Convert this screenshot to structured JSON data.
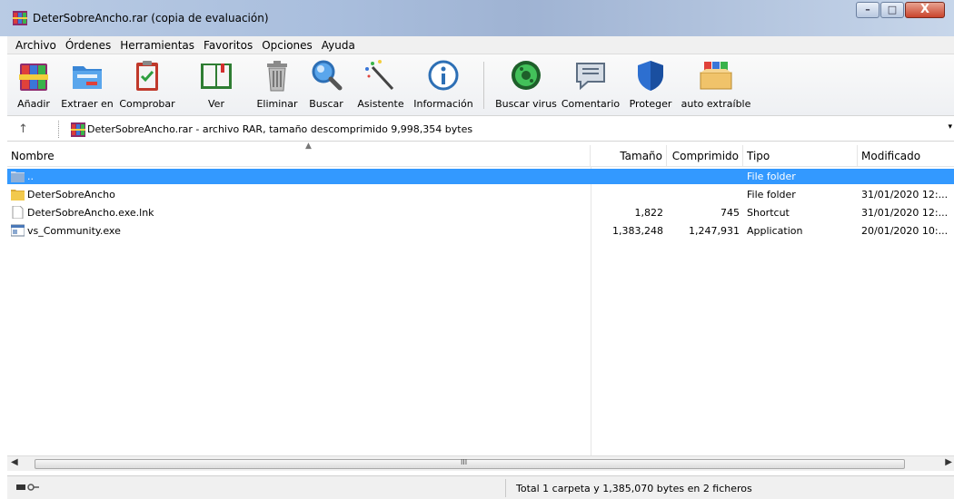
{
  "window": {
    "title": "DeterSobreAncho.rar (copia de evaluación)",
    "controls": {
      "minimize": "‗",
      "maximize": "☐",
      "close": "X"
    }
  },
  "menu": [
    "Archivo",
    "Órdenes",
    "Herramientas",
    "Favoritos",
    "Opciones",
    "Ayuda"
  ],
  "toolbar": [
    {
      "label": "Añadir",
      "icon": "add-archive-icon"
    },
    {
      "label": "Extraer en",
      "icon": "extract-folder-icon"
    },
    {
      "label": "Comprobar",
      "icon": "test-clipboard-icon"
    },
    {
      "label": "Ver",
      "icon": "view-book-icon"
    },
    {
      "label": "Eliminar",
      "icon": "trash-icon"
    },
    {
      "label": "Buscar",
      "icon": "magnifier-icon"
    },
    {
      "label": "Asistente",
      "icon": "wizard-wand-icon"
    },
    {
      "label": "Información",
      "icon": "info-icon"
    },
    {
      "label": "Buscar virus",
      "icon": "virus-scan-icon"
    },
    {
      "label": "Comentario",
      "icon": "comment-icon"
    },
    {
      "label": "Proteger",
      "icon": "shield-icon"
    },
    {
      "label": "auto extraíble",
      "icon": "sfx-box-icon"
    }
  ],
  "address": {
    "text": "DeterSobreAncho.rar - archivo RAR, tamaño descomprimido 9,998,354 bytes"
  },
  "columns": {
    "name": "Nombre",
    "size": "Tamaño",
    "packed": "Comprimido",
    "type": "Tipo",
    "modified": "Modificado"
  },
  "files": [
    {
      "name": "..",
      "size": "",
      "packed": "",
      "type": "File folder",
      "modified": "",
      "icon": "folder-icon",
      "selected": true
    },
    {
      "name": "DeterSobreAncho",
      "size": "",
      "packed": "",
      "type": "File folder",
      "modified": "31/01/2020 12:...",
      "icon": "folder-icon",
      "selected": false
    },
    {
      "name": "DeterSobreAncho.exe.lnk",
      "size": "1,822",
      "packed": "745",
      "type": "Shortcut",
      "modified": "31/01/2020 12:...",
      "icon": "file-icon",
      "selected": false
    },
    {
      "name": "vs_Community.exe",
      "size": "1,383,248",
      "packed": "1,247,931",
      "type": "Application",
      "modified": "20/01/2020 10:...",
      "icon": "application-icon",
      "selected": false
    }
  ],
  "scrollbar": {
    "grip": "III"
  },
  "status": {
    "text": "Total 1 carpeta y 1,385,070 bytes en 2 ficheros"
  },
  "colors": {
    "selection": "#3399ff",
    "titlebar": "#a9bedd"
  }
}
